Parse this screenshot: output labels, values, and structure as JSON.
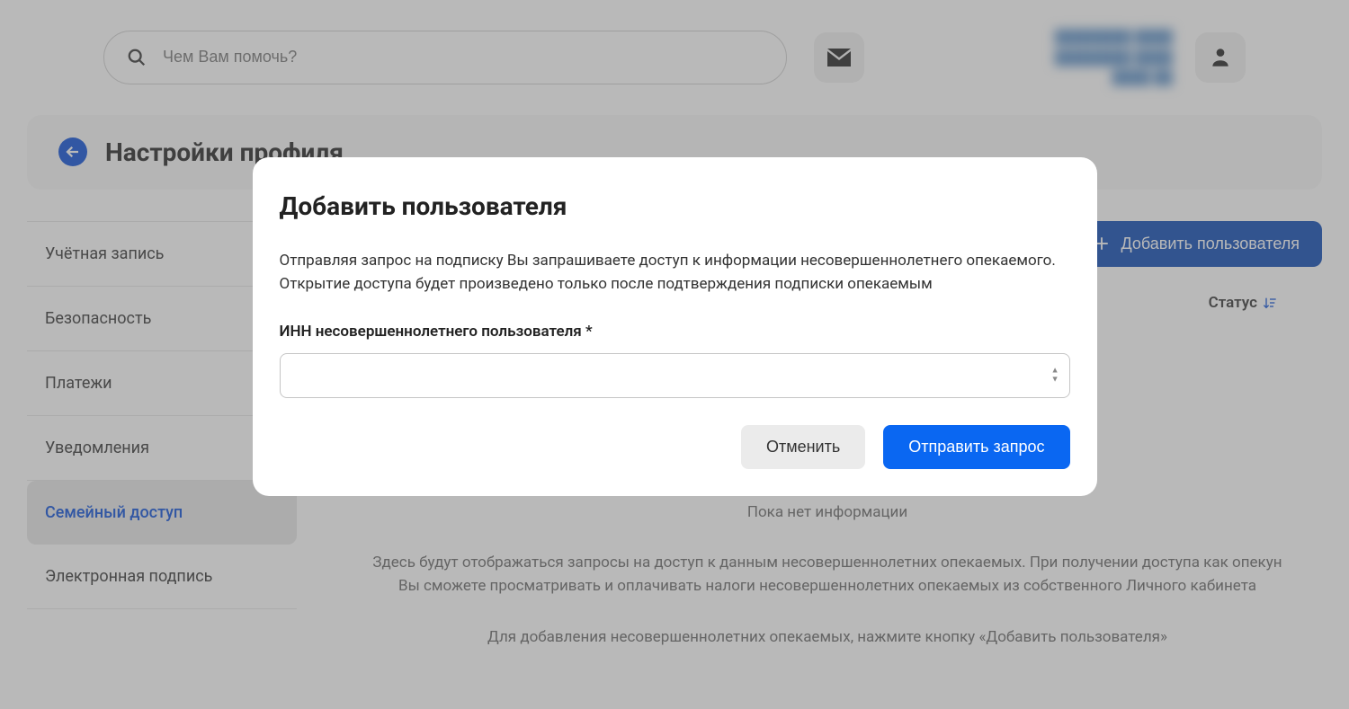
{
  "header": {
    "search_placeholder": "Чем Вам помочь?",
    "user_lines": [
      "████████ ████",
      "████████ ████",
      "████ ██"
    ]
  },
  "page_title": "Настройки профиля",
  "sidebar": {
    "items": [
      {
        "label": "Учётная запись"
      },
      {
        "label": "Безопасность"
      },
      {
        "label": "Платежи"
      },
      {
        "label": "Уведомления"
      },
      {
        "label": "Семейный доступ",
        "active": true
      },
      {
        "label": "Электронная подпись"
      }
    ]
  },
  "toolbar": {
    "add_user": "Добавить пользователя"
  },
  "table": {
    "status_header": "Статус"
  },
  "empty": {
    "no_info": "Пока нет информации",
    "p1": "Здесь будут отображаться запросы на доступ к данным несовершеннолетних опекаемых. При получении доступа как опекун Вы сможете просматривать и оплачивать налоги несовершеннолетних опекаемых из собственного Личного кабинета",
    "p2": "Для добавления несовершеннолетних опекаемых, нажмите кнопку «Добавить пользователя»"
  },
  "modal": {
    "title": "Добавить пользователя",
    "desc1": "Отправляя запрос на подписку Вы запрашиваете доступ к информации несовершеннолетнего опекаемого.",
    "desc2": "Открытие доступа будет произведено только после подтверждения подписки опекаемым",
    "input_label": "ИНН несовершеннолетнего пользователя *",
    "input_value": "",
    "cancel": "Отменить",
    "submit": "Отправить запрос"
  }
}
